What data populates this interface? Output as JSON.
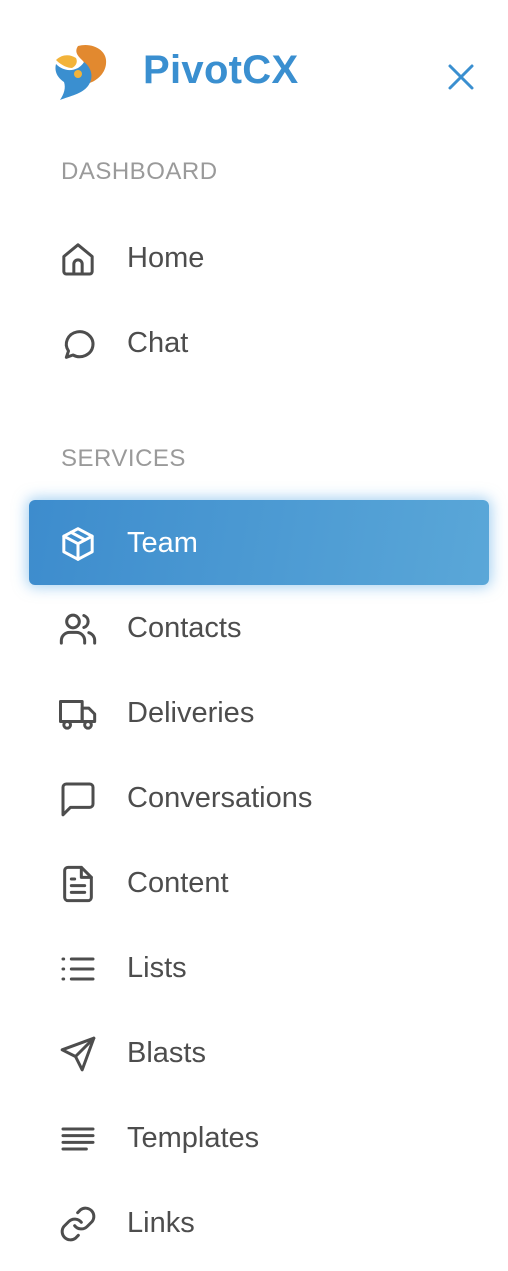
{
  "brand": {
    "name": "PivotCX",
    "colors": {
      "primary": "#3a8fd0",
      "orange": "#e2892f",
      "gold": "#f2b33a"
    }
  },
  "header": {
    "close_icon": "close-icon"
  },
  "sections": [
    {
      "label": "DASHBOARD",
      "items": [
        {
          "label": "Home",
          "icon": "home-icon"
        },
        {
          "label": "Chat",
          "icon": "chat-bubble-icon"
        }
      ]
    },
    {
      "label": "SERVICES",
      "items": [
        {
          "label": "Team",
          "icon": "box-icon",
          "active": true
        },
        {
          "label": "Contacts",
          "icon": "users-icon"
        },
        {
          "label": "Deliveries",
          "icon": "truck-icon"
        },
        {
          "label": "Conversations",
          "icon": "message-square-icon"
        },
        {
          "label": "Content",
          "icon": "file-text-icon"
        },
        {
          "label": "Lists",
          "icon": "list-icon"
        },
        {
          "label": "Blasts",
          "icon": "send-icon"
        },
        {
          "label": "Templates",
          "icon": "align-left-icon"
        },
        {
          "label": "Links",
          "icon": "link-icon"
        }
      ]
    }
  ],
  "active_color": "#4a98d3"
}
